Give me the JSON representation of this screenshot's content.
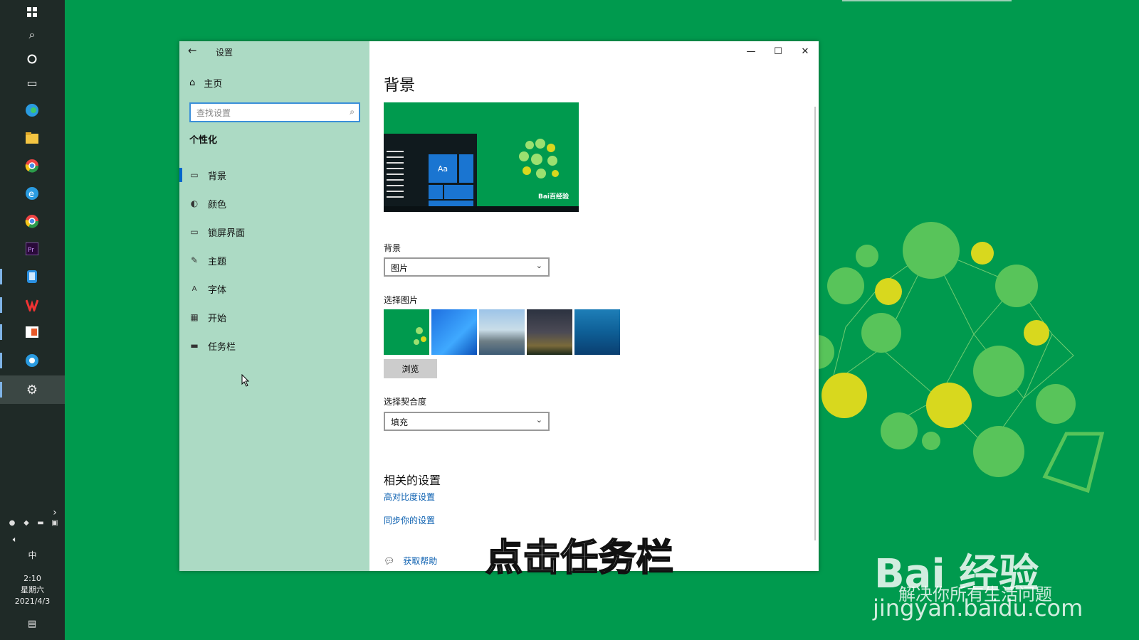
{
  "taskbar": {
    "clock_time": "2:10",
    "clock_weekday": "星期六",
    "clock_date": "2021/4/3",
    "ime": "中"
  },
  "window": {
    "title": "设置",
    "nav": {
      "home": "主页",
      "search_placeholder": "查找设置",
      "section": "个性化",
      "items": [
        {
          "label": "背景",
          "icon": "picture-icon",
          "selected": true
        },
        {
          "label": "颜色",
          "icon": "palette-icon",
          "selected": false
        },
        {
          "label": "锁屏界面",
          "icon": "lock-screen-icon",
          "selected": false
        },
        {
          "label": "主题",
          "icon": "brush-icon",
          "selected": false
        },
        {
          "label": "字体",
          "icon": "font-icon",
          "selected": false
        },
        {
          "label": "开始",
          "icon": "start-icon",
          "selected": false
        },
        {
          "label": "任务栏",
          "icon": "taskbar-icon",
          "selected": false
        }
      ]
    },
    "content": {
      "heading": "背景",
      "preview_tile": "Aa",
      "preview_logo": "Bai百经验",
      "background_label": "背景",
      "background_value": "图片",
      "choose_picture_label": "选择图片",
      "browse_button": "浏览",
      "fit_label": "选择契合度",
      "fit_value": "填充",
      "related_heading": "相关的设置",
      "links": [
        "高对比度设置",
        "同步你的设置"
      ],
      "help": "获取帮助"
    },
    "accent_color": "#0066cc"
  },
  "overlay": {
    "subtitle": "点击任务栏",
    "watermark_brand": "Bai 经验",
    "watermark_slogan": "解决你所有生活问题",
    "watermark_domain": "jingyan.baidu.com"
  }
}
